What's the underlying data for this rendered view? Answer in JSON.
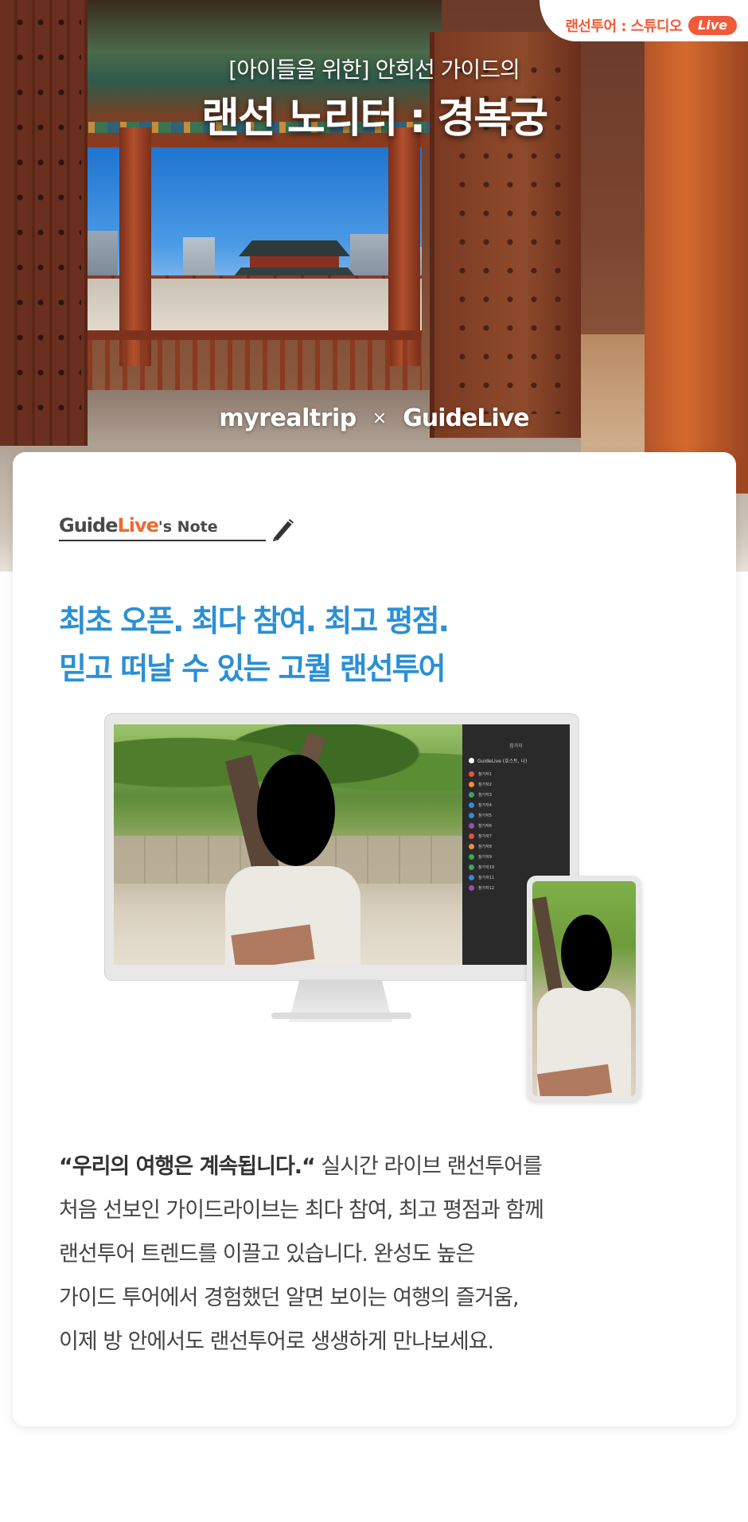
{
  "hero": {
    "tag_text": "랜선투어 : 스튜디오",
    "tag_live": "Live",
    "subtitle": "[아이들을 위한] 안희선 가이드의",
    "title": "랜선 노리터 : 경복궁",
    "brand_left": "myrealtrip",
    "brand_separator": "×",
    "brand_right": "GuideLive"
  },
  "note": {
    "guide": "Guide",
    "live": "Live",
    "suffix": "'s Note",
    "icon": "pen-icon"
  },
  "headline": {
    "line1": "최초 오픈. 최다 참여. 최고 평점.",
    "line2": "믿고 떠날 수 있는 고퀄 랜선투어"
  },
  "panel": {
    "title": "참가자",
    "host": "GuideLive (호스트, 나)",
    "participants": [
      "참가자1",
      "참가자2",
      "참가자3",
      "참가자4",
      "참가자5",
      "참가자6",
      "참가자7",
      "참가자8",
      "참가자9",
      "참가자10",
      "참가자11",
      "참가자12"
    ],
    "dot_colors": [
      "#e8503a",
      "#e8903a",
      "#3aa860",
      "#2b8fd6",
      "#2b8fd6",
      "#a04ab0",
      "#e8503a",
      "#e8903a",
      "#3aa860",
      "#3aa860",
      "#2b8fd6",
      "#a04ab0"
    ]
  },
  "body": {
    "lead": "“우리의 여행은 계속됩니다.“",
    "line1_rest": " 실시간 라이브 랜선투어를",
    "line2": "처음 선보인 가이드라이브는 최다 참여, 최고 평점과 함께",
    "line3": "랜선투어 트렌드를 이끌고 있습니다. 완성도 높은",
    "line4": "가이드 투어에서 경험했던 알면 보이는 여행의 즐거움,",
    "line5": "이제 방 안에서도 랜선투어로 생생하게 만나보세요."
  },
  "colors": {
    "accent_orange": "#ef5a3a",
    "headline_blue": "#2b8fd6"
  }
}
